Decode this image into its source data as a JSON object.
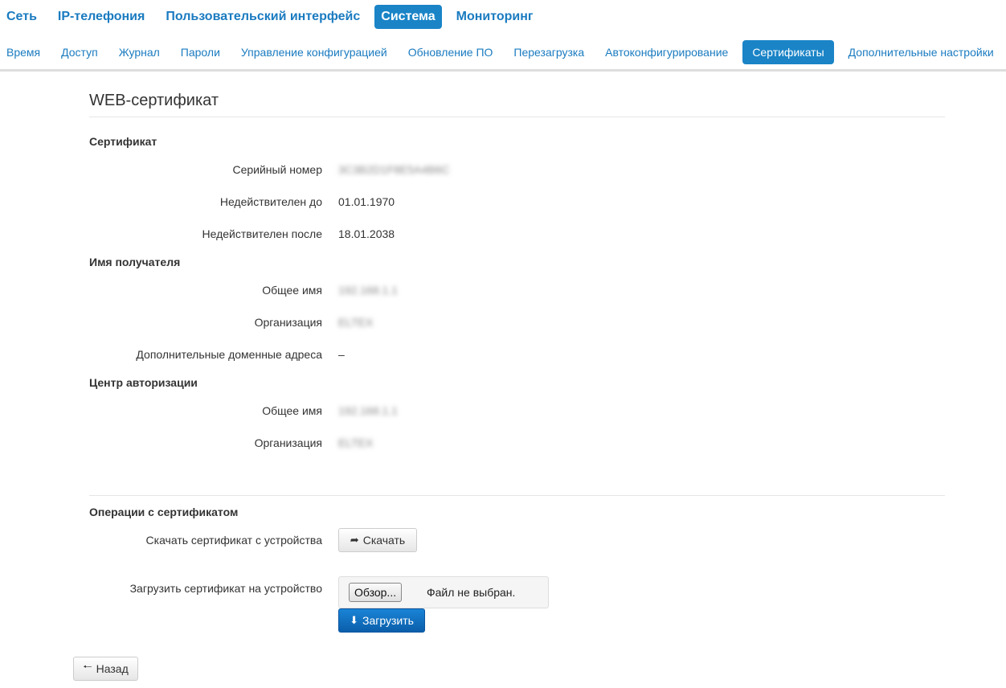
{
  "top_nav": [
    "Сеть",
    "IP-телефония",
    "Пользовательский интерфейс",
    "Система",
    "Мониторинг"
  ],
  "top_nav_active": "Система",
  "sub_nav": [
    "Время",
    "Доступ",
    "Журнал",
    "Пароли",
    "Управление конфигурацией",
    "Обновление ПО",
    "Перезагрузка",
    "Автоконфигурирование",
    "Сертификаты",
    "Дополнительные настройки"
  ],
  "sub_nav_active": "Сертификаты",
  "page_title": "WEB-сертификат",
  "certificate": {
    "heading": "Сертификат",
    "serial_label": "Серийный номер",
    "serial_value": "3C3B2D1F8E5A4B6C",
    "not_before_label": "Недействителен до",
    "not_before_value": "01.01.1970",
    "not_after_label": "Недействителен после",
    "not_after_value": "18.01.2038"
  },
  "subject": {
    "heading": "Имя получателя",
    "common_name_label": "Общее имя",
    "common_name_value": "192.168.1.1",
    "org_label": "Организация",
    "org_value": "ELTEX",
    "alt_names_label": "Дополнительные доменные адреса",
    "alt_names_value": "–"
  },
  "issuer": {
    "heading": "Центр авторизации",
    "common_name_label": "Общее имя",
    "common_name_value": "192.168.1.1",
    "org_label": "Организация",
    "org_value": "ELTEX"
  },
  "operations": {
    "heading": "Операции с сертификатом",
    "download_label": "Скачать сертификат с устройства",
    "download_button": "Скачать",
    "upload_label": "Загрузить сертификат на устройство",
    "browse_button": "Обзор...",
    "file_status": "Файл не выбран.",
    "upload_button": "Загрузить"
  },
  "back_button": "Назад",
  "colors": {
    "accent": "#1a84c7",
    "link": "#1a7bc0",
    "primary_button": "#0b5eaa"
  }
}
